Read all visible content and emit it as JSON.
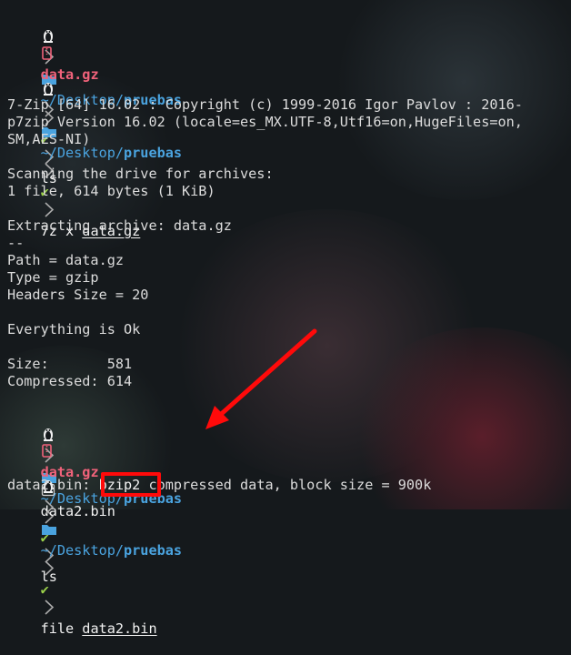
{
  "terminal": {
    "prompt_path_prefix": "~/Desktop/",
    "prompt_path_dir": "pruebas",
    "prompt_check": "✔",
    "colors": {
      "background": "#15191c",
      "file_red": "#f0627a",
      "path_blue": "#4aa3df",
      "check_green": "#9ad04a",
      "annotation_red": "#ff0a0a"
    },
    "prompt1": {
      "command": "ls"
    },
    "ls1": {
      "file": "data.gz"
    },
    "prompt2": {
      "command": "7z x ",
      "arg": "data.gz"
    },
    "output7z": [
      "7-Zip [64] 16.02 : Copyright (c) 1999-2016 Igor Pavlov : 2016-",
      "p7zip Version 16.02 (locale=es_MX.UTF-8,Utf16=on,HugeFiles=on,",
      "SM,AES-NI)",
      "",
      "Scanning the drive for archives:",
      "1 file, 614 bytes (1 KiB)",
      "",
      "Extracting archive: data.gz",
      "--",
      "Path = data.gz",
      "Type = gzip",
      "Headers Size = 20",
      "",
      "Everything is Ok",
      "",
      "Size:       581",
      "Compressed: 614"
    ],
    "prompt3": {
      "command": "ls"
    },
    "ls2": {
      "file1": "data.gz",
      "file2": "data2.bin"
    },
    "prompt4": {
      "command": "file ",
      "arg": "data2.bin"
    },
    "file_output": {
      "prefix": "data2.bin: ",
      "highlight": "bzip2",
      "rest": " compressed data, block size = 900k"
    }
  }
}
